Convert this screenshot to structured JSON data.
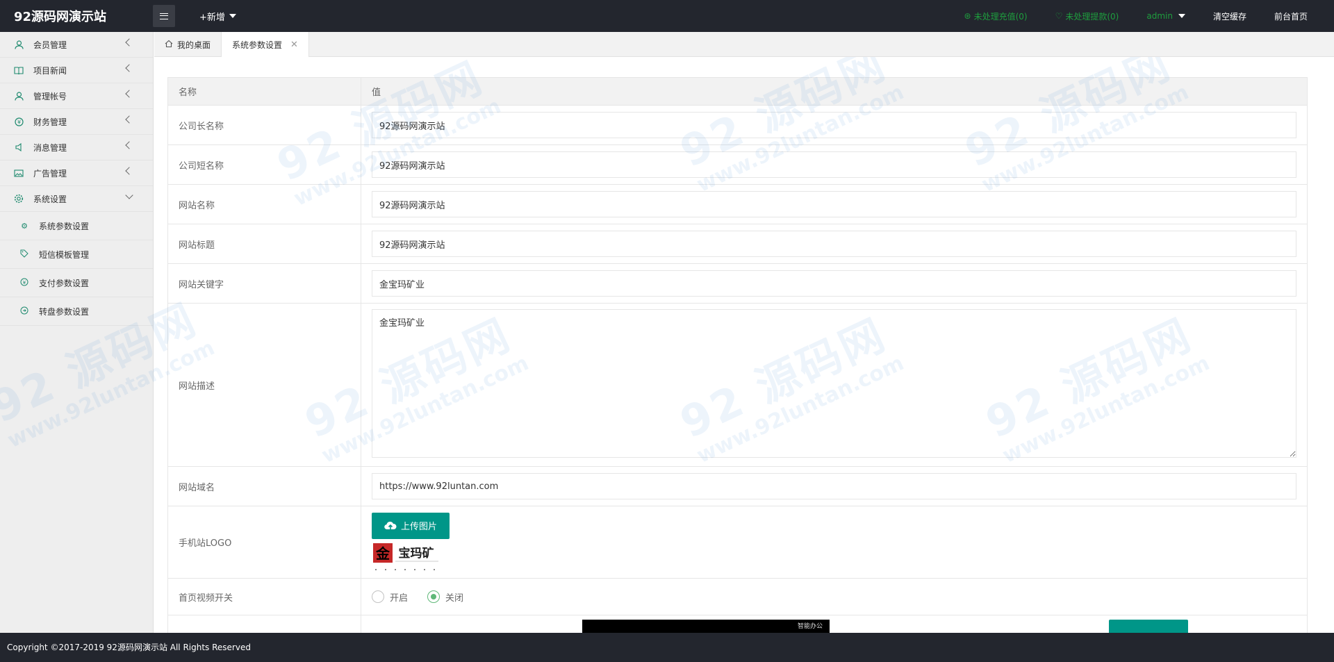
{
  "header": {
    "logo": "92源码网演示站",
    "add_new": "+新增",
    "pending_recharge": "未处理充值(0)",
    "pending_withdraw": "未处理提款(0)",
    "user": "admin",
    "clear_cache": "清空缓存",
    "front_home": "前台首页"
  },
  "sidebar": {
    "items": [
      {
        "label": "会员管理",
        "icon": "user-icon"
      },
      {
        "label": "项目新闻",
        "icon": "book-icon"
      },
      {
        "label": "管理帐号",
        "icon": "admin-icon"
      },
      {
        "label": "财务管理",
        "icon": "money-icon"
      },
      {
        "label": "消息管理",
        "icon": "speaker-icon"
      },
      {
        "label": "广告管理",
        "icon": "image-icon"
      },
      {
        "label": "系统设置",
        "icon": "gear-icon"
      }
    ],
    "subitems": [
      {
        "label": "系统参数设置",
        "icon": "gear-icon"
      },
      {
        "label": "短信模板管理",
        "icon": "tag-icon"
      },
      {
        "label": "支付参数设置",
        "icon": "money-icon"
      },
      {
        "label": "转盘参数设置",
        "icon": "wheel-icon"
      }
    ]
  },
  "tabs": [
    {
      "label": "我的桌面"
    },
    {
      "label": "系统参数设置"
    }
  ],
  "table": {
    "col_name": "名称",
    "col_value": "值",
    "rows": [
      {
        "label": "公司长名称",
        "value": "92源码网演示站"
      },
      {
        "label": "公司短名称",
        "value": "92源码网演示站"
      },
      {
        "label": "网站名称",
        "value": "92源码网演示站"
      },
      {
        "label": "网站标题",
        "value": "92源码网演示站"
      },
      {
        "label": "网站关键字",
        "value": "金宝玛矿业"
      }
    ],
    "desc_label": "网站描述",
    "desc_value": "金宝玛矿业",
    "domain_label": "网站域名",
    "domain_value": "https://www.92luntan.com",
    "logo_label": "手机站LOGO",
    "upload_btn": "上传图片",
    "logo_text": "宝玛矿",
    "logo_char": "金",
    "video_label": "首页视频开关",
    "video_on": "开启",
    "video_off": "关闭",
    "video_selected": "关闭"
  },
  "bottom_strip_text": "智能办公",
  "watermark": {
    "big": "92 源码网",
    "small": "www.92luntan.com"
  },
  "footer": {
    "copyright": "Copyright ©2017-2019 92源码网演示站 All Rights Reserved"
  }
}
